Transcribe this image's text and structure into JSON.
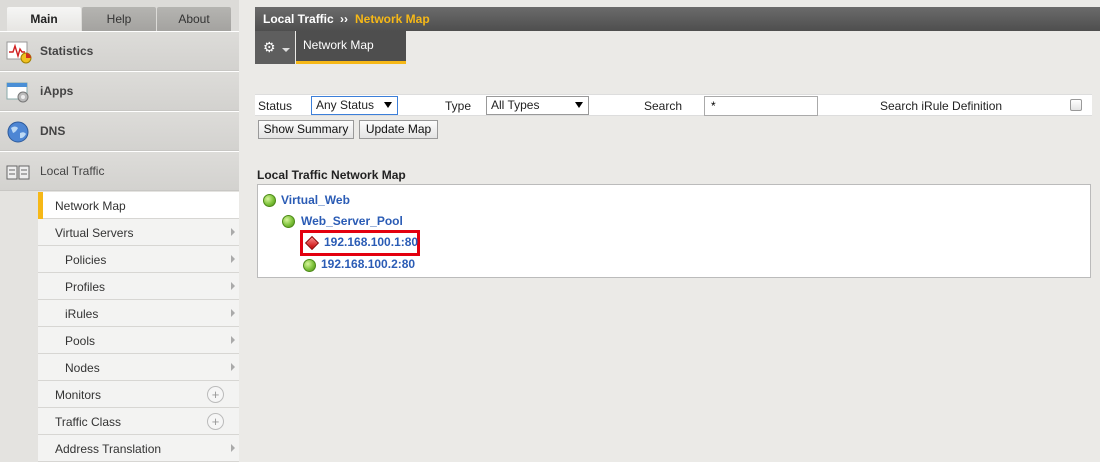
{
  "tabs": [
    {
      "label": "Main",
      "active": true
    },
    {
      "label": "Help",
      "active": false
    },
    {
      "label": "About",
      "active": false
    }
  ],
  "sidebar": {
    "sections": [
      {
        "label": "Statistics",
        "icon": "statistics-icon"
      },
      {
        "label": "iApps",
        "icon": "iapps-icon"
      },
      {
        "label": "DNS",
        "icon": "globe-icon"
      },
      {
        "label": "Local Traffic",
        "icon": "local-traffic-icon"
      }
    ],
    "items": [
      {
        "label": "Network Map",
        "active": true
      },
      {
        "label": "Virtual Servers"
      },
      {
        "label": "Policies"
      },
      {
        "label": "Profiles"
      },
      {
        "label": "iRules"
      },
      {
        "label": "Pools"
      },
      {
        "label": "Nodes"
      },
      {
        "label": "Monitors"
      },
      {
        "label": "Traffic Class"
      },
      {
        "label": "Address Translation"
      }
    ]
  },
  "header": {
    "section": "Local Traffic",
    "separator": "››",
    "page": "Network Map"
  },
  "subnav": {
    "tab": "Network Map",
    "menu_icon": "gear-icon"
  },
  "filter": {
    "status_label": "Status",
    "status_value": "Any Status",
    "type_label": "Type",
    "type_value": "All Types",
    "search_label": "Search",
    "search_value": "*",
    "irule_label": "Search iRule Definition",
    "irule_checked": false
  },
  "buttons": {
    "show_summary": "Show Summary",
    "update_map": "Update Map"
  },
  "map": {
    "title": "Local Traffic Network Map",
    "virtual_server": {
      "name": "Virtual_Web",
      "status": "green"
    },
    "pool": {
      "name": "Web_Server_Pool",
      "status": "green"
    },
    "members": [
      {
        "name": "192.168.100.1:80",
        "status": "red"
      },
      {
        "name": "192.168.100.2:80",
        "status": "green"
      }
    ]
  },
  "colors": {
    "accent": "#f6b817",
    "link": "#2b5cb5",
    "highlight": "#e3000f"
  }
}
